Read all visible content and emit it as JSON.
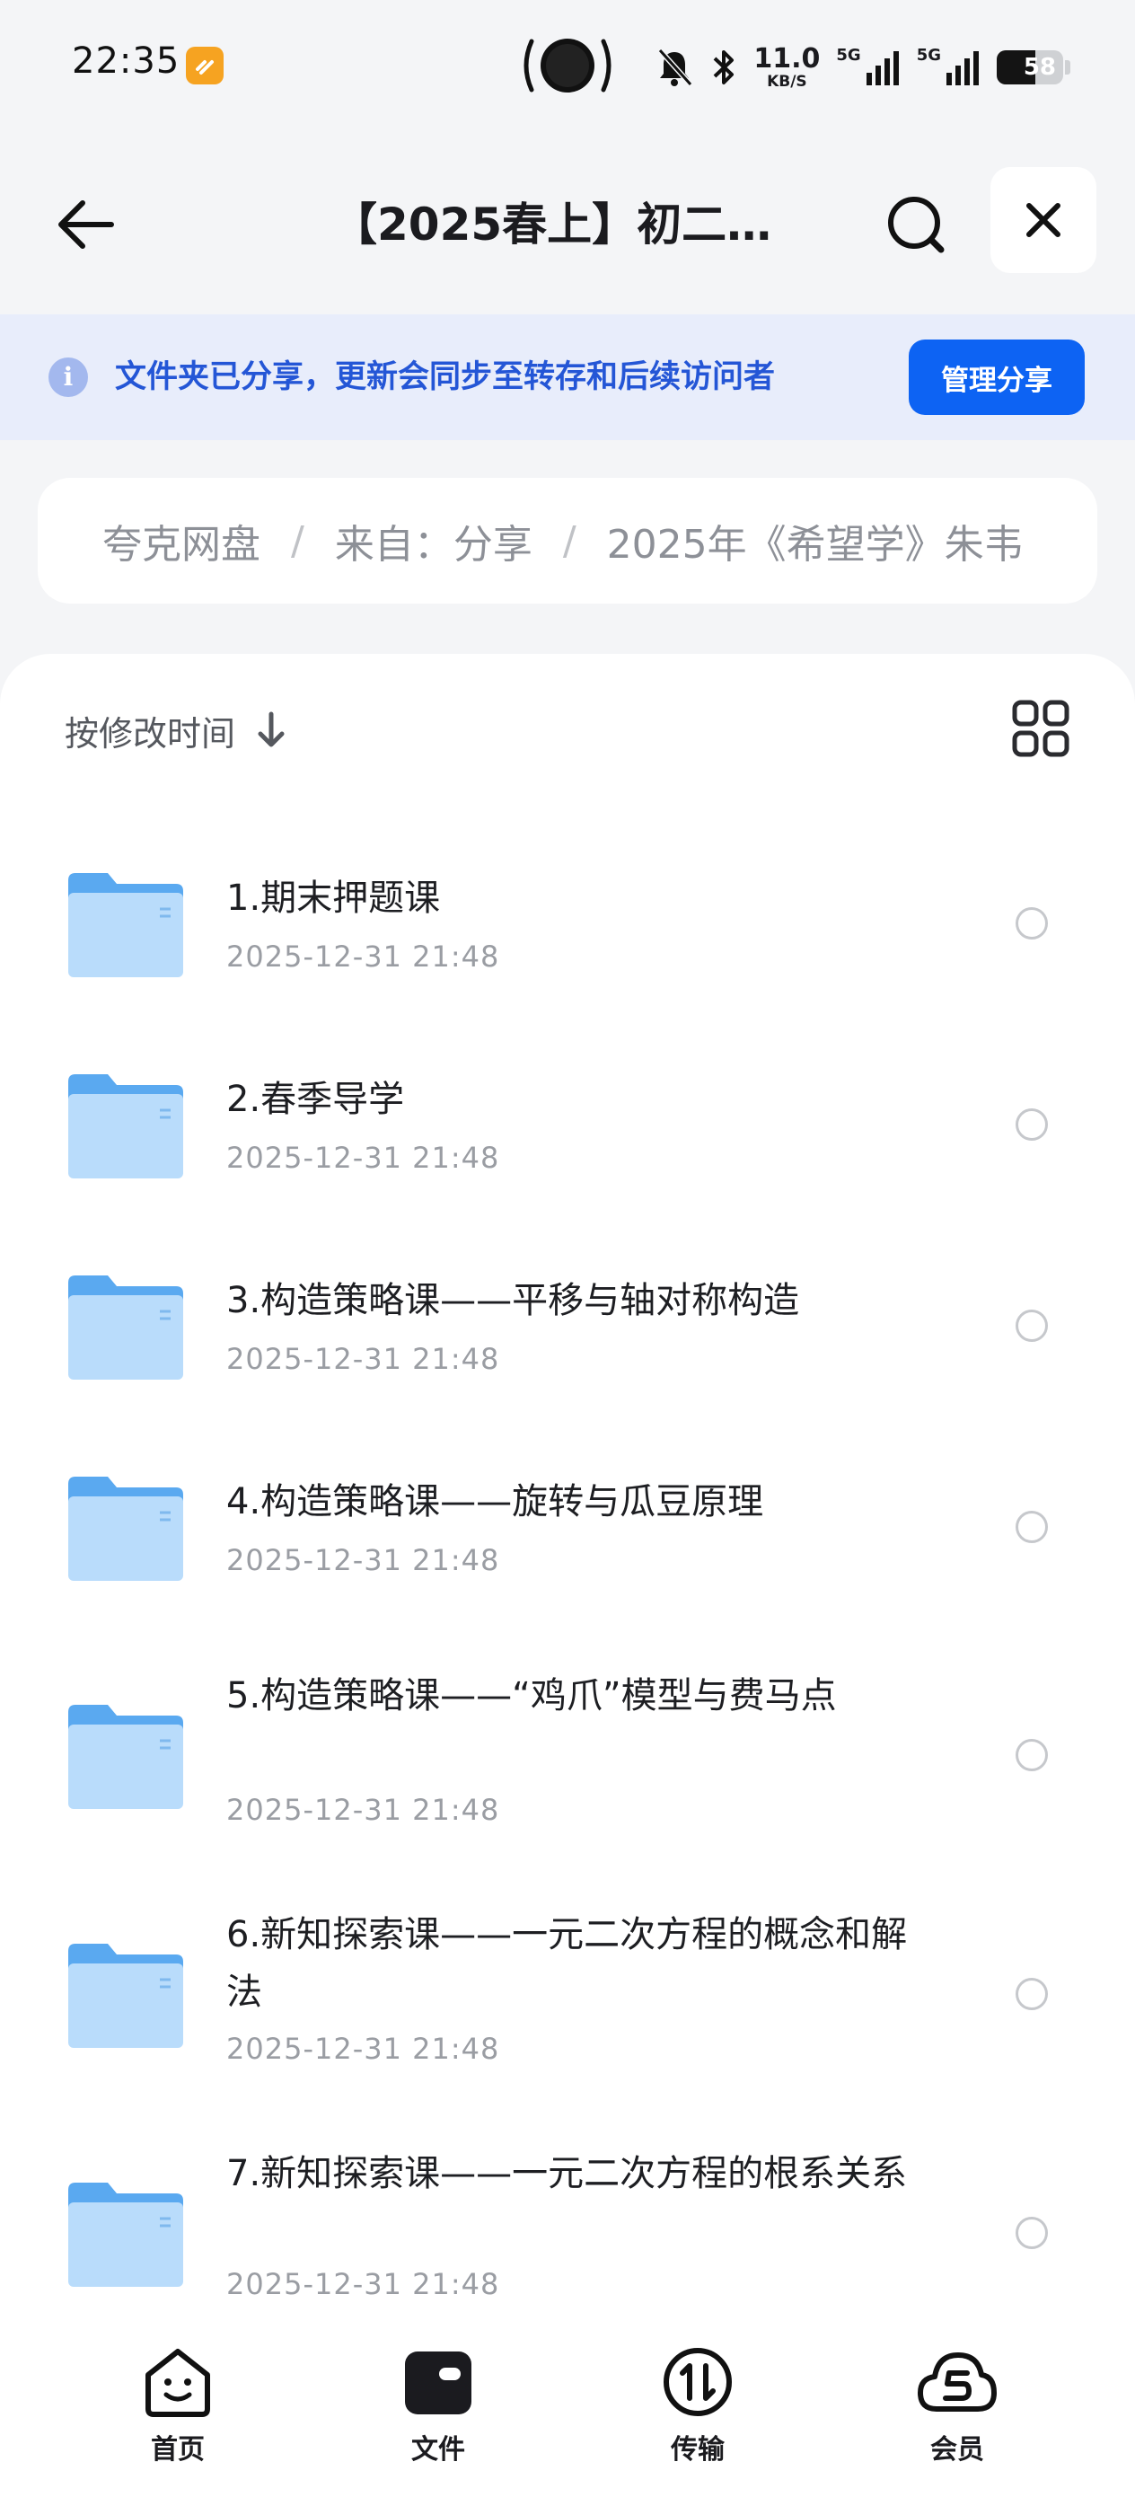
{
  "status_bar": {
    "time": "22:35",
    "net_speed": "11.0",
    "net_speed_unit": "KB/S",
    "signal_1": "5G",
    "signal_2": "5G",
    "battery_level": "58",
    "icons": [
      "app-badge-icon",
      "mute-bell-icon",
      "bluetooth-icon",
      "signal-icon",
      "battery-icon"
    ]
  },
  "header": {
    "title": "【2025春上】初二…",
    "icons": [
      "back-arrow-icon",
      "search-icon",
      "close-icon"
    ]
  },
  "banner": {
    "text": "文件夹已分享，更新会同步至转存和后续访问者",
    "button_label": "管理分享",
    "accent": "#0d63f3",
    "text_color": "#2456d6",
    "background": "#e8edfb"
  },
  "breadcrumb": {
    "items": [
      "夸克网盘",
      "来自：分享",
      "2025年《希望学》朱韦"
    ],
    "separator": "/"
  },
  "sort": {
    "label": "按修改时间",
    "direction_icon": "arrow-down-icon",
    "view_toggle_icon": "grid-view-icon"
  },
  "files": [
    {
      "name": "1.期末押题课",
      "date": "2025-12-31 21:48"
    },
    {
      "name": "2.春季导学",
      "date": "2025-12-31 21:48"
    },
    {
      "name": "3.构造策略课——平移与轴对称构造",
      "date": "2025-12-31 21:48"
    },
    {
      "name": "4.构造策略课——旋转与瓜豆原理",
      "date": "2025-12-31 21:48"
    },
    {
      "name": "5.构造策略课——“鸡爪”模型与费马点",
      "date": "2025-12-31 21:48"
    },
    {
      "name": "6.新知探索课——一元二次方程的概念和解法",
      "date": "2025-12-31 21:48"
    },
    {
      "name": "7.新知探索课——一元二次方程的根系关系",
      "date": "2025-12-31 21:48"
    }
  ],
  "bottom_nav": {
    "items": [
      {
        "label": "首页",
        "icon": "home-face-icon"
      },
      {
        "label": "文件",
        "icon": "wallet-folder-icon",
        "active": true
      },
      {
        "label": "传输",
        "icon": "transfer-icon"
      },
      {
        "label": "会员",
        "icon": "member-cloud-icon"
      }
    ]
  },
  "colors": {
    "folder_light": "#b9dcfb",
    "folder_dark": "#5aa9f0",
    "page_background": "#f4f5f7"
  }
}
